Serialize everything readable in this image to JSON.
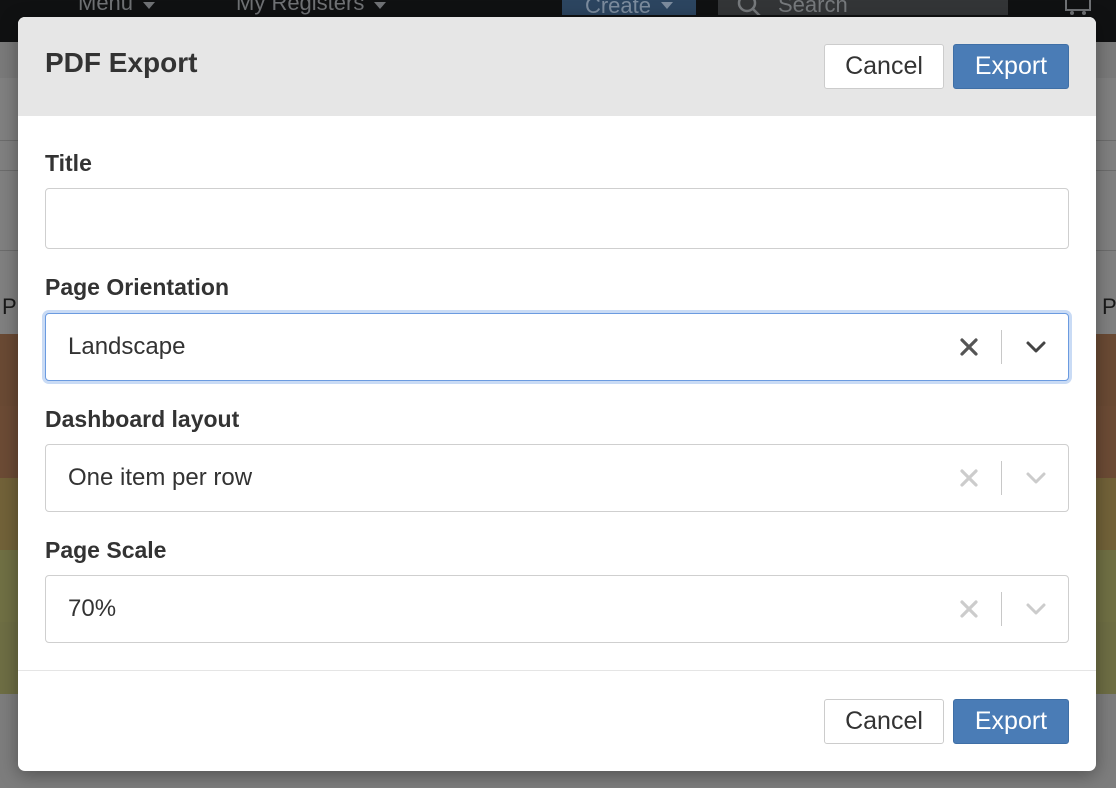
{
  "background_app": {
    "nav": {
      "menu_label": "Menu",
      "registers_label": "My Registers",
      "create_label": "Create",
      "search_placeholder": "Search"
    },
    "edge_letters": {
      "left": "P",
      "right": "P"
    }
  },
  "dialog": {
    "title": "PDF Export",
    "header_cancel_label": "Cancel",
    "header_export_label": "Export",
    "footer_cancel_label": "Cancel",
    "footer_export_label": "Export",
    "fields": {
      "title": {
        "label": "Title",
        "value": ""
      },
      "page_orientation": {
        "label": "Page Orientation",
        "value": "Landscape"
      },
      "dashboard_layout": {
        "label": "Dashboard layout",
        "value": "One item per row"
      },
      "page_scale": {
        "label": "Page Scale",
        "value": "70%"
      }
    }
  },
  "colors": {
    "primary_button": "#4a7cb6",
    "focus_ring": "#6b9be0",
    "header_bg": "#e6e6e6"
  },
  "icons": {
    "clear": "close-icon",
    "dropdown": "chevron-down-icon",
    "search": "search-icon"
  }
}
